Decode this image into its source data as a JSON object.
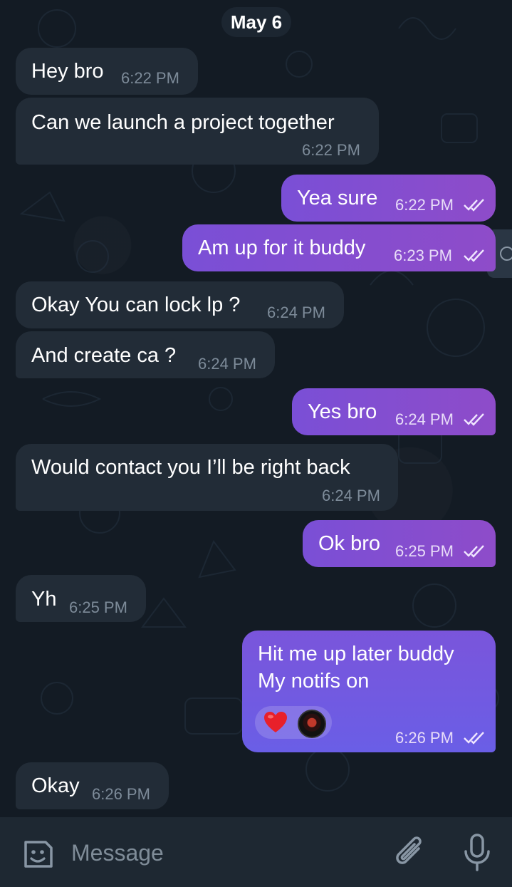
{
  "date_label": "May 6",
  "messages": [
    {
      "dir": "in",
      "text": "Hey bro",
      "time": "6:22 PM"
    },
    {
      "dir": "in",
      "text": "Can we launch a project together",
      "time": "6:22 PM"
    },
    {
      "dir": "out",
      "text": "Yea sure",
      "time": "6:22 PM",
      "status": "read"
    },
    {
      "dir": "out",
      "text": "Am up for it buddy",
      "time": "6:23 PM",
      "status": "read"
    },
    {
      "dir": "in",
      "text": "Okay You can lock lp ?",
      "time": "6:24 PM"
    },
    {
      "dir": "in",
      "text": "And create ca ?",
      "time": "6:24 PM"
    },
    {
      "dir": "out",
      "text": "Yes bro",
      "time": "6:24 PM",
      "status": "read"
    },
    {
      "dir": "in",
      "text": "Would contact you I’ll be right back",
      "time": "6:24 PM"
    },
    {
      "dir": "out",
      "text": "Ok bro",
      "time": "6:25 PM",
      "status": "read"
    },
    {
      "dir": "in",
      "text": "Yh",
      "time": "6:25 PM"
    },
    {
      "dir": "out",
      "text_line1": "Hit me up later buddy",
      "text_line2": "My notifs on",
      "time": "6:26 PM",
      "status": "read",
      "reactions": [
        "heart-icon",
        "avatar"
      ]
    },
    {
      "dir": "in",
      "text": "Okay",
      "time": "6:26 PM"
    }
  ],
  "input": {
    "placeholder": "Message",
    "icons": [
      "sticker-icon",
      "attach-icon",
      "mic-icon"
    ]
  },
  "colors": {
    "background": "#131b24",
    "incoming_bubble": "#222c37",
    "outgoing_bubble": "#7a4fd6",
    "input_bar": "#1e2832"
  }
}
